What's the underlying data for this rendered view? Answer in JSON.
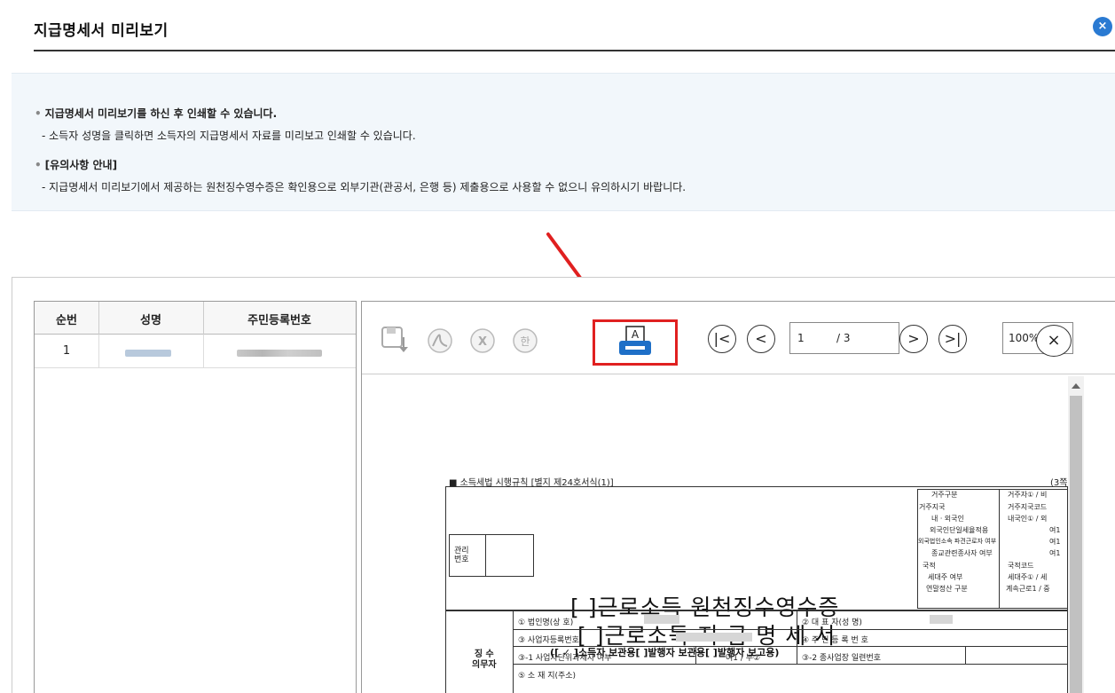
{
  "header": {
    "title": "지급명세서 미리보기",
    "close_icon": "×"
  },
  "notice": {
    "line1": "지급명세서 미리보기를 하신 후 인쇄할 수 있습니다.",
    "line2": "- 소득자 성명을 클릭하면 소득자의 지급명세서 자료를 미리보고 인쇄할 수 있습니다.",
    "line3": "[유의사항 안내]",
    "line4": "- 지급명세서 미리보기에서 제공하는 원천징수영수증은 확인용으로 외부기관(관공서, 은행 등) 제출용으로 사용할 수 없으니 유의하시기 바랍니다.",
    "bullet": "•"
  },
  "list": {
    "headers": [
      "순번",
      "성명",
      "주민등록번호"
    ],
    "rows": [
      {
        "no": "1"
      }
    ]
  },
  "viewer": {
    "toolbar": {
      "save_icon": "save-icon",
      "pdf_icon": "pdf-icon",
      "excel_icon": "excel-icon",
      "hwp_icon": "hwp-icon",
      "print_icon": "print-icon",
      "first_label": "|<",
      "prev_label": "<",
      "next_label": ">",
      "last_label": ">|",
      "current_page": "1",
      "total_pages": "/ 3",
      "zoom": "100%",
      "close_label": "×"
    },
    "doc": {
      "law_ref": "■ 소득세법 시행규칙 [별지 제24호서식(1)]",
      "page_mark": "(3쪽",
      "title1": "[ ]근로소득 원천징수영수증",
      "title2": "[ ]근로소득 지 급 명 세 서",
      "subtitle": "([ ✓ ]소득자 보관용[    ]발행자 보관용[    ]발행자 보고용)",
      "mgmt_no": "관리\n번호",
      "right_table": [
        "거주구분",
        "거주자① / 비",
        "거주지국",
        "거주지국코드",
        "내ㆍ외국인",
        "내국인① / 외",
        "외국인단일세율적용",
        "여1",
        "외국법인소속 파견근로자 여부",
        "여1",
        "종교관련종사자 여부",
        "여1",
        "국적",
        "국적코드",
        "세대주 여부",
        "세대주① / 세",
        "연말정산 구분",
        "계속근로1 / 중"
      ],
      "withholder": "징 수\n의무자",
      "row1a": "① 법인명(상 호)",
      "row1b": "② 대 표 자(성 명)",
      "row2a": "③ 사업자등록번호",
      "row2b": "④ 주 민 등 록 번 호",
      "row3a": "③-1 사업자단위과세자 여부",
      "row3b": "여1 / 부②",
      "row3c": "③-2 종사업장 일련번호",
      "row4a": "⑤ 소 재 지(주소)"
    }
  },
  "colors": {
    "accent": "#2a7ad2",
    "highlight": "#e02020",
    "notice_bg": "#f2f7fb"
  }
}
